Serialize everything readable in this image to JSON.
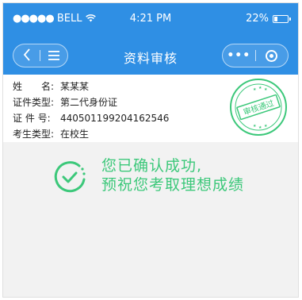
{
  "status_bar": {
    "carrier": "BELL",
    "time": "4:21 PM",
    "battery": "22%",
    "battery_level": 0.22
  },
  "nav": {
    "back_icon": "chevron-left",
    "menu_icon": "hamburger",
    "title": "资料审核",
    "more_icon": "more-dots",
    "close_icon": "target-circle"
  },
  "info": {
    "name_label": "姓　　名:",
    "name_value": "某某某",
    "id_type_label": "证件类型:",
    "id_type_value": "第二代身份证",
    "id_number_label": "证 件 号:",
    "id_number_value": "440501199204162546",
    "student_type_label": "考生类型:",
    "student_type_value": "在校生"
  },
  "stamp": {
    "text": "审核通过",
    "color": "#3cc87a"
  },
  "success": {
    "line1": "您已确认成功,",
    "line2": "预祝您考取理想成绩",
    "color": "#3cc87a"
  },
  "colors": {
    "header": "#2f8fe4",
    "background": "#f2f2f2"
  }
}
